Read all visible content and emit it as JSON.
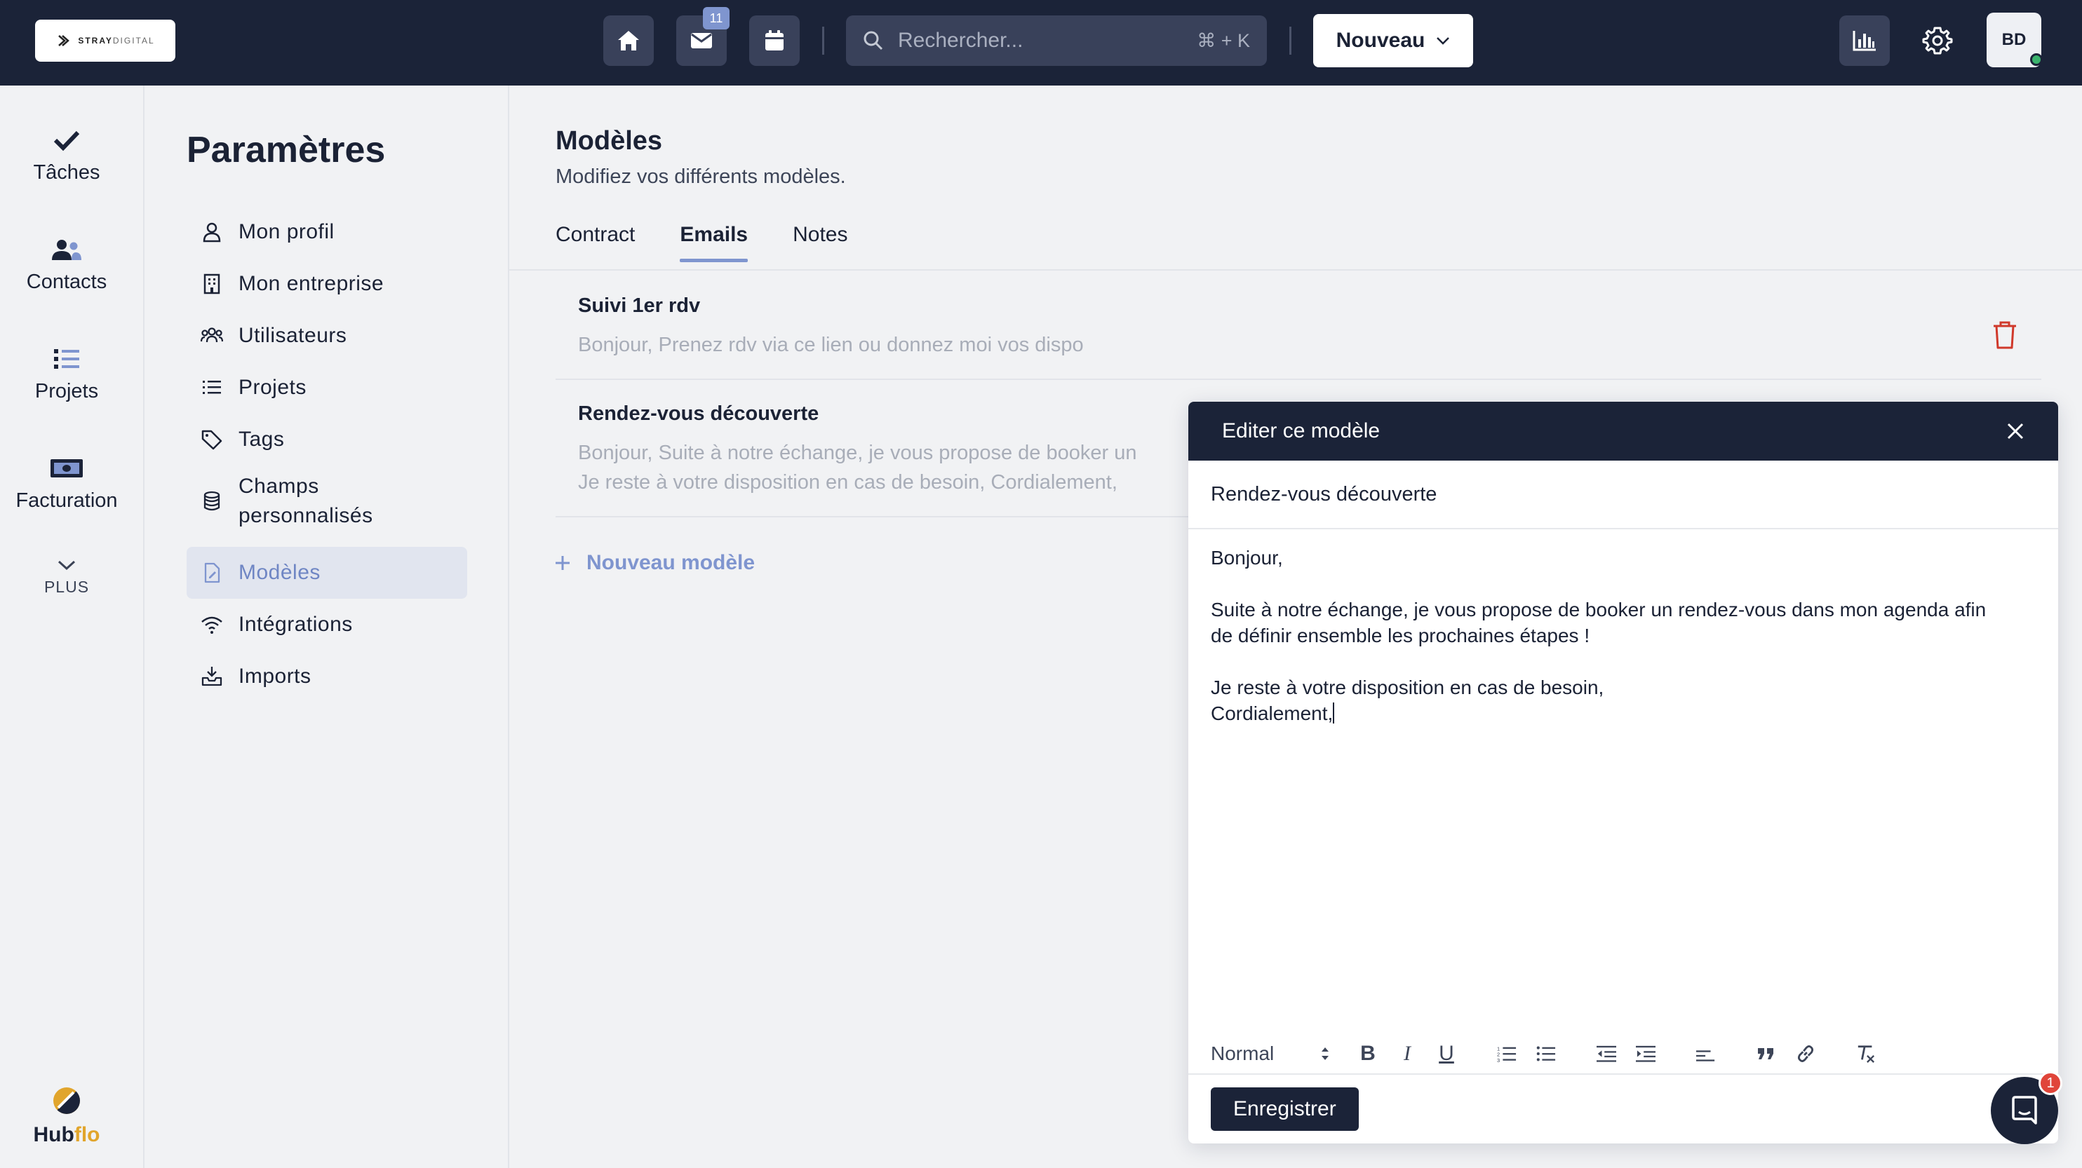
{
  "header": {
    "logo_brand": "STRAY",
    "logo_suffix": "DIGITAL",
    "inbox_badge": "11",
    "search_placeholder": "Rechercher...",
    "search_shortcut": "⌘ + K",
    "new_button": "Nouveau",
    "avatar_initials": "BD"
  },
  "rail": {
    "items": [
      {
        "label": "Tâches",
        "icon": "check-icon"
      },
      {
        "label": "Contacts",
        "icon": "people-icon"
      },
      {
        "label": "Projets",
        "icon": "list-icon"
      },
      {
        "label": "Facturation",
        "icon": "billing-icon"
      }
    ],
    "more": "PLUS",
    "brand_a": "Hub",
    "brand_b": "flo"
  },
  "settings": {
    "title": "Paramètres",
    "items": [
      {
        "label": "Mon profil",
        "icon": "user-icon"
      },
      {
        "label": "Mon entreprise",
        "icon": "building-icon"
      },
      {
        "label": "Utilisateurs",
        "icon": "users-icon"
      },
      {
        "label": "Projets",
        "icon": "list-icon"
      },
      {
        "label": "Tags",
        "icon": "tag-icon"
      },
      {
        "label": "Champs",
        "label2": "personnalisés",
        "icon": "database-icon"
      },
      {
        "label": "Modèles",
        "icon": "document-icon",
        "active": true
      },
      {
        "label": "Intégrations",
        "icon": "wifi-icon"
      },
      {
        "label": "Imports",
        "icon": "import-icon"
      }
    ]
  },
  "main": {
    "title": "Modèles",
    "subtitle": "Modifiez vos différents modèles.",
    "tabs": [
      "Contract",
      "Emails",
      "Notes"
    ],
    "active_tab": "Emails",
    "templates": [
      {
        "name": "Suivi 1er rdv",
        "preview": [
          "Bonjour, Prenez rdv via ce lien ou donnez moi vos dispo"
        ]
      },
      {
        "name": "Rendez-vous découverte",
        "preview": [
          "Bonjour, Suite à notre échange, je vous propose de booker un",
          "Je reste à votre disposition en cas de besoin, Cordialement,"
        ]
      }
    ],
    "new_template": "Nouveau modèle"
  },
  "editor": {
    "title": "Editer ce modèle",
    "name_value": "Rendez-vous découverte",
    "body": {
      "line1": "Bonjour,",
      "line2": "Suite à notre échange, je vous propose de booker un rendez-vous dans mon agenda afin",
      "line3": "de définir ensemble les prochaines étapes !",
      "line4": "Je reste à votre disposition en cas de besoin,",
      "line5": "Cordialement,"
    },
    "format_select": "Normal",
    "toolbar": {
      "bold": "B",
      "italic": "I",
      "underline": "U"
    },
    "save_button": "Enregistrer"
  },
  "chat": {
    "badge": "1"
  },
  "colors": {
    "navy": "#1b2338",
    "accent": "#7f95cf",
    "danger": "#d0392b",
    "brand_orange": "#e1a52c"
  }
}
